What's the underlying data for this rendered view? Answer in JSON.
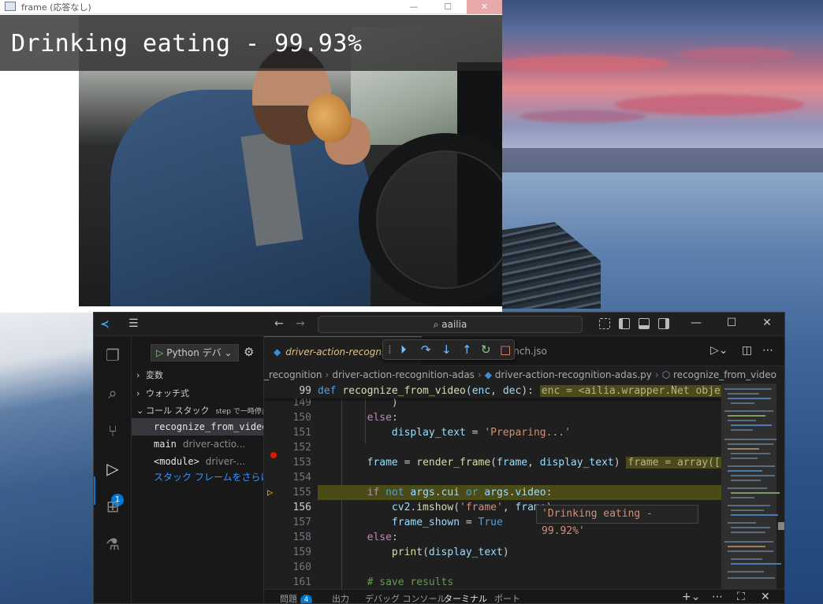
{
  "frame_window": {
    "title": "frame (応答なし)",
    "overlay_text": "Drinking eating - 99.93%"
  },
  "vscode": {
    "search_text": "aailia",
    "sidebar": {
      "run_config": "Python デバ",
      "sections": {
        "variables": "変数",
        "watch": "ウォッチ式",
        "call_stack": "コール スタック",
        "call_stack_status": "step で一時停止"
      },
      "stack_frames": [
        {
          "fn": "recognize_from_video",
          "file": ""
        },
        {
          "fn": "main",
          "file": "driver-actio..."
        },
        {
          "fn": "<module>",
          "file": "driver-..."
        }
      ],
      "more_frames": "スタック フレームをさらに読み込む",
      "debug_badge": "1"
    },
    "tabs": {
      "active": "driver-action-recognition-adas.py",
      "other": "launch.json"
    },
    "breadcrumbs": [
      "_recognition",
      "driver-action-recognition-adas",
      "driver-action-recognition-adas.py",
      "recognize_from_video"
    ],
    "sticky": {
      "line": "99",
      "code": "def recognize_from_video(enc, dec):",
      "inline": "enc = <ailia.wrapper.Net object"
    },
    "hover_value": "'Drinking eating - 99.92%'",
    "lines": [
      {
        "n": "149",
        "code": ")"
      },
      {
        "n": "150",
        "code": "else:"
      },
      {
        "n": "151",
        "code": "display_text = 'Preparing...'"
      },
      {
        "n": "152",
        "code": ""
      },
      {
        "n": "153",
        "code": "frame = render_frame(frame, display_text)",
        "inline": "frame = array([["
      },
      {
        "n": "154",
        "code": ""
      },
      {
        "n": "155",
        "code": "if not args.cui or args.video:"
      },
      {
        "n": "156",
        "code": "cv2.imshow('frame', frame)"
      },
      {
        "n": "157",
        "code": "frame_shown = True"
      },
      {
        "n": "158",
        "code": "else:"
      },
      {
        "n": "159",
        "code": "print(display_text)"
      },
      {
        "n": "160",
        "code": ""
      },
      {
        "n": "161",
        "code": "# save results"
      }
    ],
    "panel_tabs": {
      "problems": "問題",
      "problems_count": "4",
      "output": "出力",
      "debug_console": "デバッグ コンソール",
      "terminal": "ターミナル",
      "ports": "ポート"
    }
  }
}
